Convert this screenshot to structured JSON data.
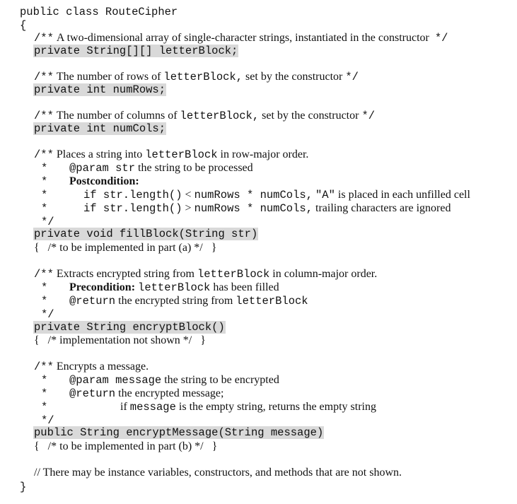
{
  "class_header": "public class RouteCipher",
  "open_brace": "{",
  "close_brace": "}",
  "field1": {
    "comment_open": "/**",
    "comment_text": "A two-dimensional array of single-character strings, instantiated in the constructor",
    "comment_close": "*/",
    "declaration": "private String[][] letterBlock;"
  },
  "field2": {
    "comment_open": "/**",
    "comment_text_a": "The number of rows of",
    "comment_code": "letterBlock,",
    "comment_text_b": "set by the constructor",
    "comment_close": "*/",
    "declaration": "private int numRows;"
  },
  "field3": {
    "comment_open": "/**",
    "comment_text_a": "The number of columns of",
    "comment_code": "letterBlock,",
    "comment_text_b": "set by the constructor",
    "comment_close": "*/",
    "declaration": "private int numCols;"
  },
  "method1": {
    "comment_open": "/**",
    "summary_a": "Places a string into",
    "summary_code": "letterBlock",
    "summary_b": "in row-major order.",
    "star": "*",
    "param_tag": "@param str",
    "param_text": "the string to be processed",
    "post_label": "Postcondition:",
    "cond1_code_a": "if str.length()",
    "cond1_op": "<",
    "cond1_code_b": "numRows * numCols,",
    "cond1_code_c": "\"A\"",
    "cond1_text": "is placed in each unfilled cell",
    "cond2_code_a": "if str.length()",
    "cond2_op": ">",
    "cond2_code_b": "numRows * numCols,",
    "cond2_text": "trailing characters are ignored",
    "comment_close": "*/",
    "signature": "private void fillBlock(String str)",
    "body": "{   /* to be implemented in part (a) */   }"
  },
  "method2": {
    "comment_open": "/**",
    "summary_a": "Extracts encrypted string from",
    "summary_code": "letterBlock",
    "summary_b": "in column-major order.",
    "star": "*",
    "pre_label": "Precondition:",
    "pre_code": "letterBlock",
    "pre_text": "has been filled",
    "return_tag": "@return",
    "return_text": "the encrypted string from",
    "return_code": "letterBlock",
    "comment_close": "*/",
    "signature": "private String encryptBlock()",
    "body": "{   /* implementation not shown */   }"
  },
  "method3": {
    "comment_open": "/**",
    "summary": "Encrypts a message.",
    "star": "*",
    "param_tag": "@param message",
    "param_text": "the string to be encrypted",
    "return_tag": "@return",
    "return_text": "the encrypted message;",
    "cond_a": "if",
    "cond_code": "message",
    "cond_b": "is the empty string, returns the empty string",
    "comment_close": "*/",
    "signature": "public String encryptMessage(String message)",
    "body": "{   /* to be implemented in part (b) */   }"
  },
  "footer_comment": "// There may be instance variables, constructors, and methods that are not shown."
}
